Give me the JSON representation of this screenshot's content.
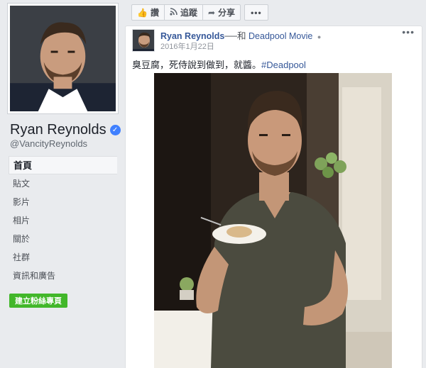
{
  "page": {
    "name": "Ryan Reynolds",
    "handle": "@VancityReynolds",
    "verified": true
  },
  "nav": [
    {
      "label": "首頁",
      "active": true
    },
    {
      "label": "貼文",
      "active": false
    },
    {
      "label": "影片",
      "active": false
    },
    {
      "label": "相片",
      "active": false
    },
    {
      "label": "關於",
      "active": false
    },
    {
      "label": "社群",
      "active": false
    },
    {
      "label": "資訊和廣告",
      "active": false
    }
  ],
  "create_page_label": "建立粉絲專頁",
  "actions": {
    "like_label": "讚",
    "follow_label": "追蹤",
    "share_label": "分享",
    "more_label": "•••"
  },
  "post": {
    "author": "Ryan Reynolds",
    "with_text": "──和",
    "movie": "Deadpool Movie",
    "date": "2016年1月22日",
    "menu_label": "•••",
    "text_main": "臭豆腐，死侍說到做到，就醬。",
    "hashtag": "#Deadpool"
  },
  "icons": {
    "like": "thumbs-up-icon",
    "follow": "rss-icon",
    "share": "share-arrow-icon",
    "verified": "verified-check-icon",
    "privacy": "globe-icon"
  },
  "colors": {
    "link": "#365899",
    "create_button": "#42b72a",
    "verified": "#4080ff",
    "background": "#e9ebee"
  }
}
